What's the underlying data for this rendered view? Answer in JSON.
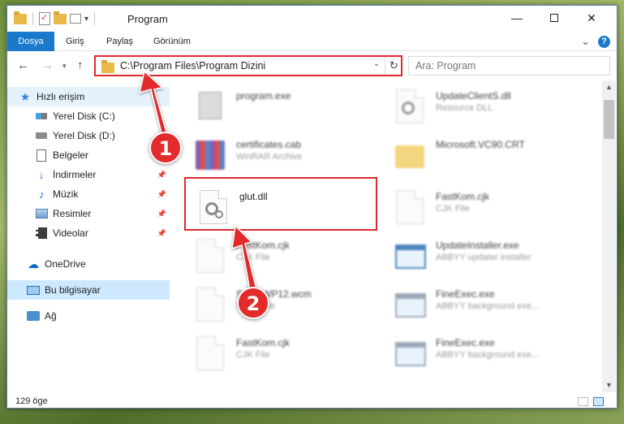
{
  "window": {
    "title": "Program",
    "qat_dropdown": "▾",
    "controls": {
      "minimize": "—",
      "close": "✕"
    }
  },
  "ribbon": {
    "tabs": [
      "Dosya",
      "Giriş",
      "Paylaş",
      "Görünüm"
    ],
    "expand": "⌄",
    "help": "?"
  },
  "nav": {
    "back": "←",
    "forward": "→",
    "history": "▾",
    "up": "↑",
    "address": "C:\\Program Files\\Program Dizini",
    "address_dropdown": "⌄",
    "refresh": "↻",
    "search_placeholder": "Ara: Program"
  },
  "sidebar": {
    "items": [
      {
        "label": "Hızlı erişim"
      },
      {
        "label": "Yerel Disk (C:)"
      },
      {
        "label": "Yerel Disk (D:)"
      },
      {
        "label": "Belgeler"
      },
      {
        "label": "İndirmeler"
      },
      {
        "label": "Müzik"
      },
      {
        "label": "Resimler"
      },
      {
        "label": "Videolar"
      },
      {
        "label": "OneDrive"
      },
      {
        "label": "Bu bilgisayar"
      },
      {
        "label": "Ağ"
      }
    ],
    "pin_glyph": "📌"
  },
  "files": [
    {
      "name": "program.exe",
      "type": ""
    },
    {
      "name": "UpdateClientS.dll",
      "type": "Resource DLL"
    },
    {
      "name": "certificates.cab",
      "type": "WinRAR Archive"
    },
    {
      "name": "Microsoft.VC90.CRT",
      "type": ""
    },
    {
      "name": "glut.dll",
      "type": ""
    },
    {
      "name": "FastKom.cjk",
      "type": "CJK File"
    },
    {
      "name": "FastKom.cjk",
      "type": "CJK File"
    },
    {
      "name": "UpdateInstaller.exe",
      "type": "ABBYY updater installer"
    },
    {
      "name": "SmartWP12.wcm",
      "type": "WCM File"
    },
    {
      "name": "FineExec.exe",
      "type": "ABBYY background exe..."
    },
    {
      "name": "FastKom.cjk",
      "type": "CJK File"
    },
    {
      "name": "FineExec.exe",
      "type": "ABBYY background exe..."
    }
  ],
  "status": {
    "count": "129 öge"
  },
  "annotations": {
    "step1": "1",
    "step2": "2"
  },
  "colors": {
    "accent": "#1979ca",
    "highlight": "#e0282d",
    "badge": "#e32b2b"
  }
}
